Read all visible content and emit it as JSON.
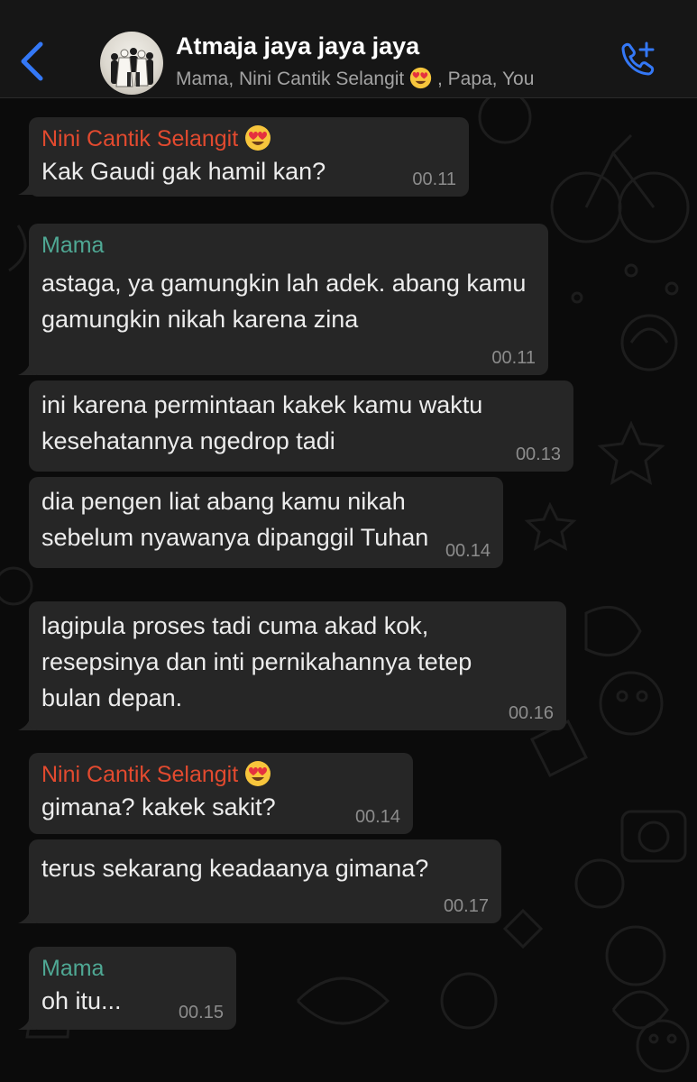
{
  "header": {
    "back_icon": "chevron-left-icon",
    "title": "Atmaja jaya jaya jaya",
    "participants_start": "Mama, Nini Cantik Selangit",
    "participants_end": ", Papa, You",
    "participants_emoji": "heart-eyes-emoji",
    "call_icon": "add-call-icon"
  },
  "colors": {
    "accent": "#3478f6",
    "sender_nini": "#e24a2f",
    "sender_mama": "#4fa894",
    "bubble": "#262626",
    "background": "#0b0b0b"
  },
  "messages": [
    {
      "sender": "Nini Cantik Selangit",
      "emoji": "heart-eyes-emoji",
      "text": "Kak Gaudi gak hamil kan?",
      "time": "00.11"
    },
    {
      "sender": "Mama",
      "text": "astaga, ya gamungkin lah adek. abang kamu gamungkin nikah karena zina",
      "time": "00.11"
    },
    {
      "text": "ini karena permintaan kakek kamu waktu kesehatannya ngedrop tadi",
      "time": "00.13"
    },
    {
      "text": "dia pengen liat abang kamu nikah sebelum nyawanya dipanggil Tuhan",
      "time": "00.14"
    },
    {
      "text": "lagipula proses tadi cuma akad kok, resepsinya dan inti pernikahannya tetep bulan depan.",
      "time": "00.16"
    },
    {
      "sender": "Nini Cantik Selangit",
      "emoji": "heart-eyes-emoji",
      "text": "gimana? kakek sakit?",
      "time": "00.14"
    },
    {
      "text": "terus sekarang keadaanya gimana?",
      "time": "00.17"
    },
    {
      "sender": "Mama",
      "text": "oh itu...",
      "time": "00.15"
    }
  ]
}
